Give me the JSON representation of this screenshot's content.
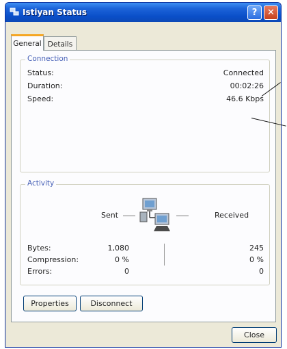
{
  "window": {
    "title": "Istiyan Status",
    "help_label": "?",
    "close_label": "✕"
  },
  "tabs": [
    {
      "label": "General",
      "active": true
    },
    {
      "label": "Details",
      "active": false
    }
  ],
  "connection": {
    "legend": "Connection",
    "rows": [
      {
        "label": "Status:",
        "value": "Connected"
      },
      {
        "label": "Duration:",
        "value": "00:02:26"
      },
      {
        "label": "Speed:",
        "value": "46.6 Kbps"
      }
    ]
  },
  "activity": {
    "legend": "Activity",
    "sent_label": "Sent",
    "received_label": "Received",
    "rows": [
      {
        "label": "Bytes:",
        "sent": "1,080",
        "received": "245"
      },
      {
        "label": "Compression:",
        "sent": "0 %",
        "received": "0 %"
      },
      {
        "label": "Errors:",
        "sent": "0",
        "received": "0"
      }
    ]
  },
  "buttons": {
    "properties": "Properties",
    "disconnect": "Disconnect",
    "close": "Close"
  },
  "icons": {
    "app": "network-connection-icon",
    "activity": "network-computers-icon"
  },
  "colors": {
    "title_bar": "#0a4fc9",
    "group_legend": "#4660b6",
    "window_face": "#ece9d8",
    "tab_accent": "#f5a623"
  }
}
